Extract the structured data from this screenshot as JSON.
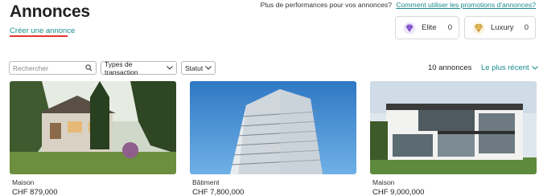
{
  "header": {
    "title": "Annonces",
    "create_link": "Créer une annonce",
    "promo_text": "Plus de performances pour vos annonces?",
    "promo_link": "Comment utiliser les promotions d'annonces?"
  },
  "badges": [
    {
      "label": "Elite",
      "count": "0",
      "icon": "diamond-icon"
    },
    {
      "label": "Luxury",
      "count": "0",
      "icon": "gem-icon"
    }
  ],
  "filters": {
    "search_placeholder": "Rechercher",
    "transaction_label": "Types de transaction",
    "status_label": "Statut"
  },
  "results": {
    "count": "10 annonces",
    "sort_label": "Le plus récent"
  },
  "listings": [
    {
      "type": "Maison",
      "price": "CHF 879,000"
    },
    {
      "type": "Bâtiment",
      "price": "CHF 7,800,000"
    },
    {
      "type": "Maison",
      "price": "CHF 9,000,000"
    }
  ],
  "colors": {
    "accent": "#1a8a8f",
    "underline": "#e5322d"
  }
}
